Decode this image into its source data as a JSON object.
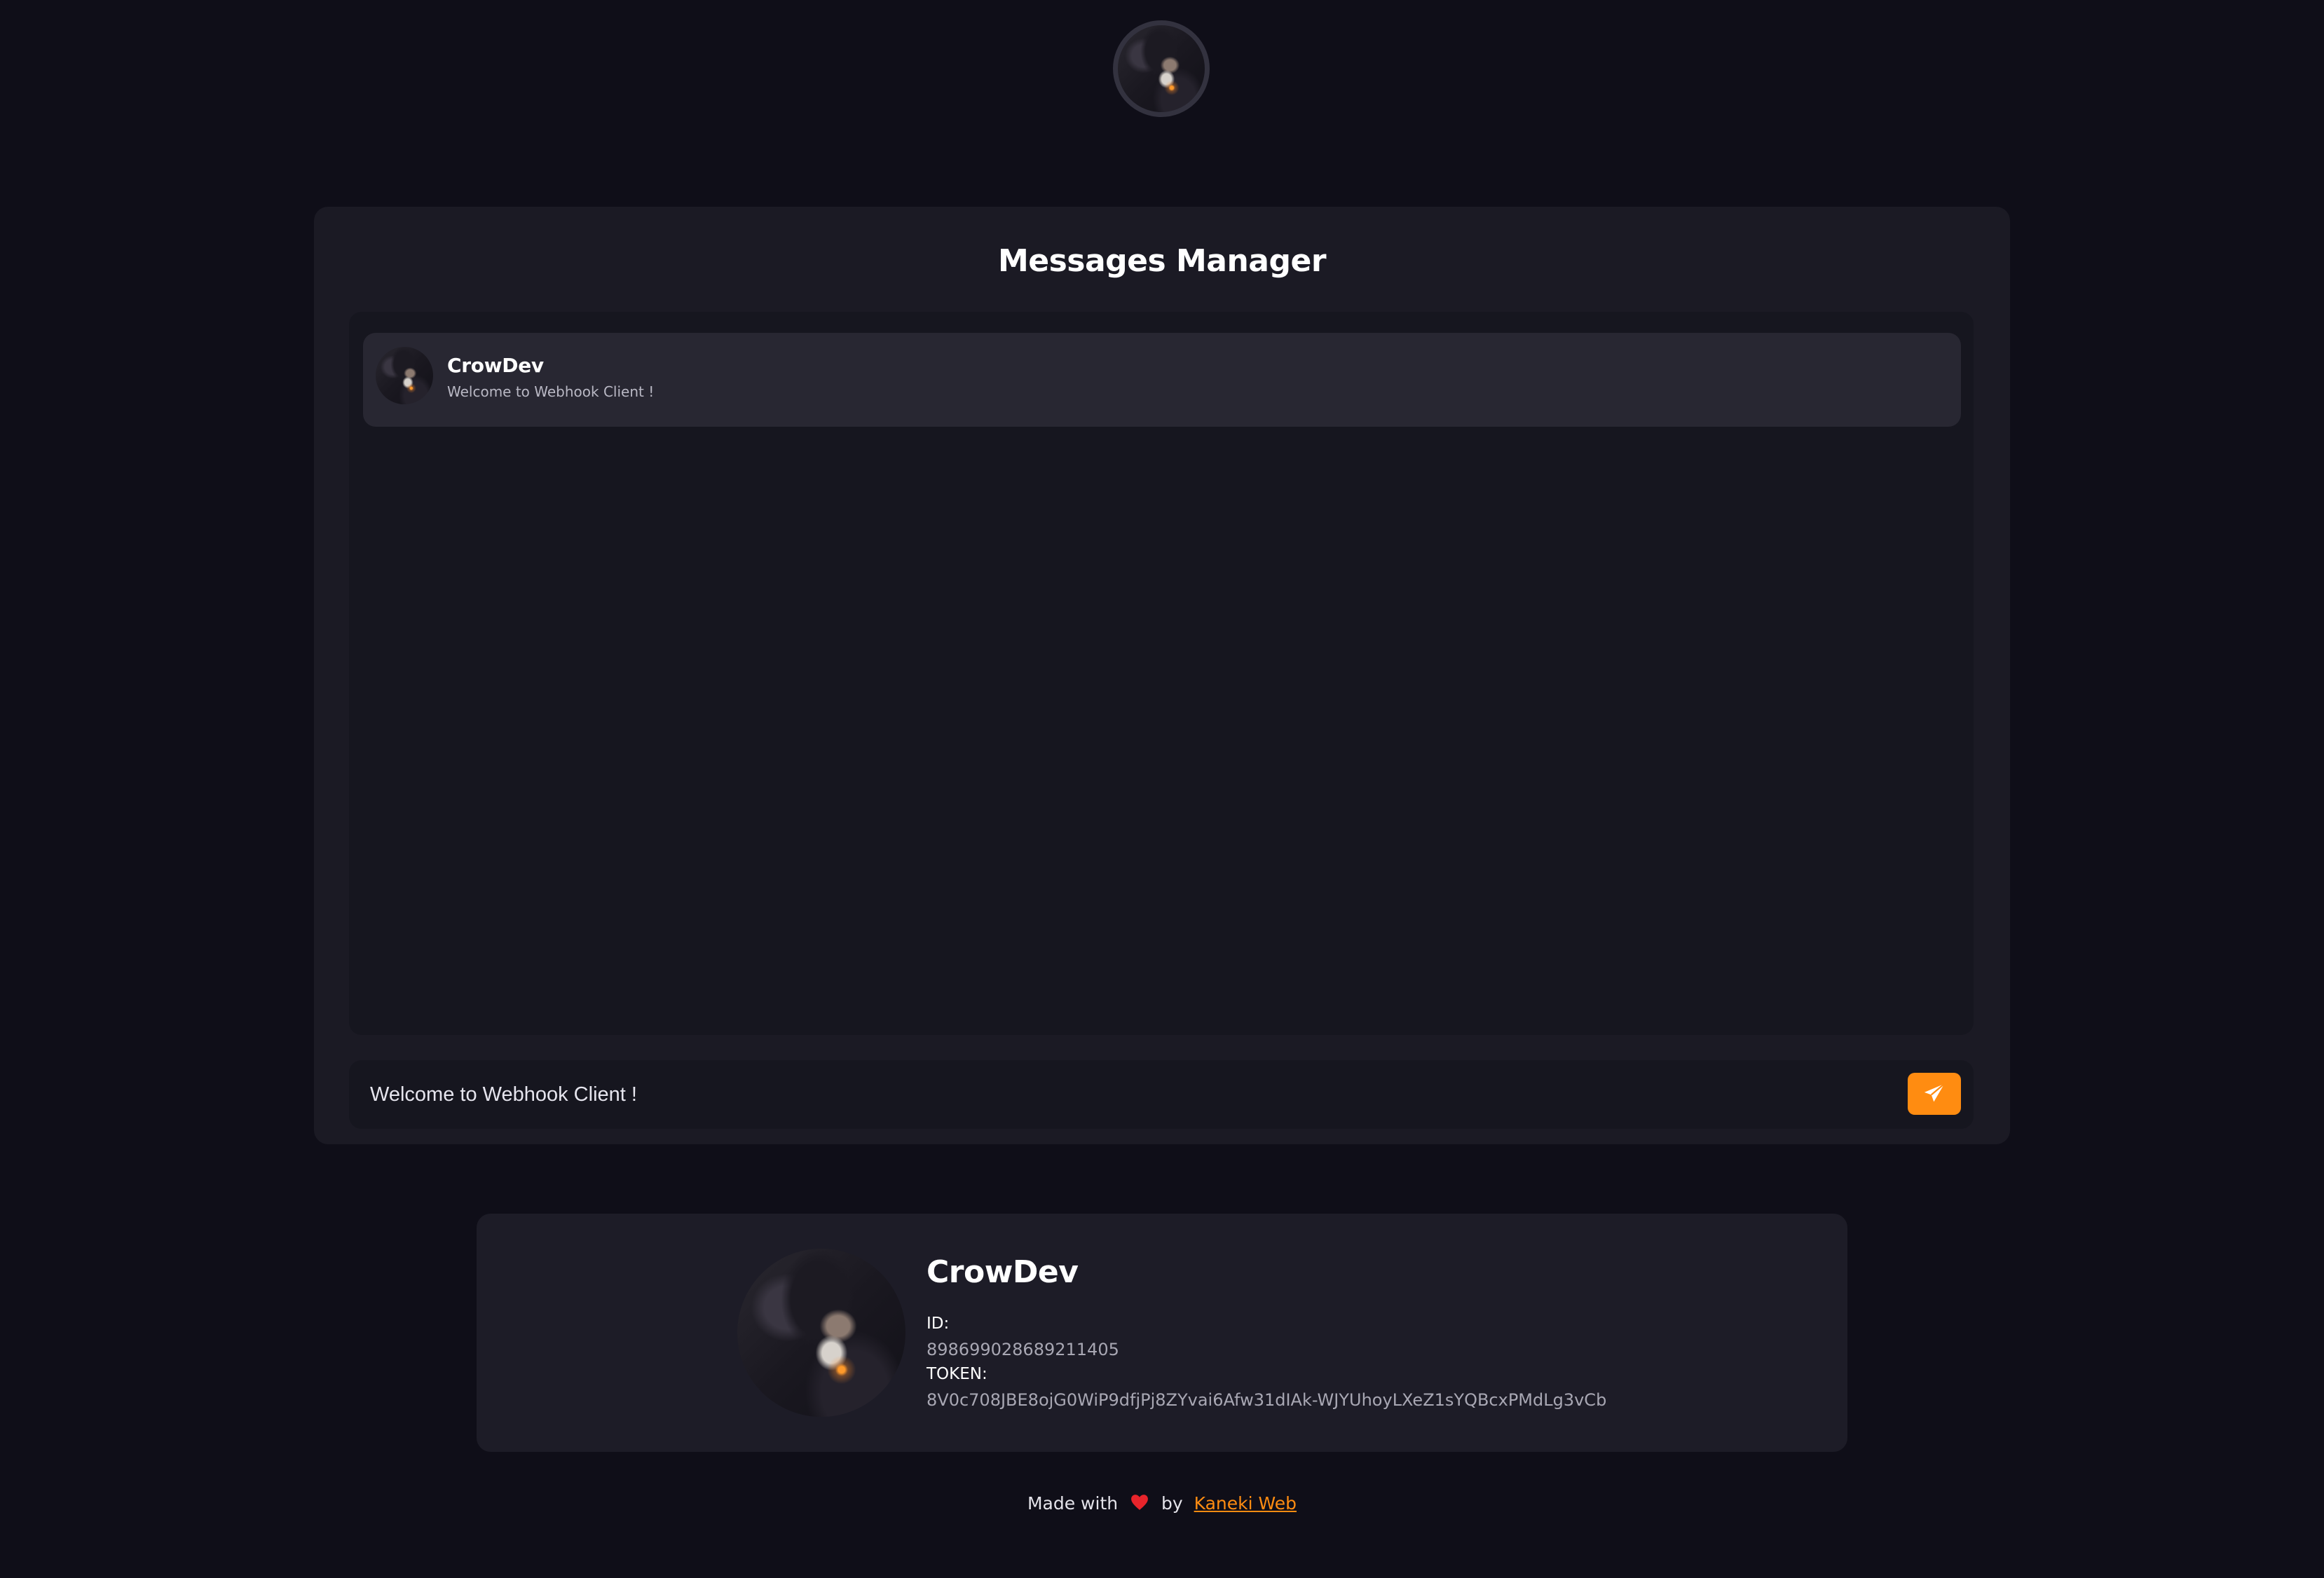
{
  "header": {
    "avatar_alt": "CrowDev avatar"
  },
  "panel": {
    "title": "Messages Manager",
    "messages": [
      {
        "author": "CrowDev",
        "text": "Welcome to Webhook Client !"
      }
    ],
    "composer": {
      "value": "Welcome to Webhook Client !",
      "placeholder": ""
    },
    "send_icon": "paper-plane-icon"
  },
  "profile": {
    "name": "CrowDev",
    "id_label": "ID:",
    "id_value": "898699028689211405",
    "token_label": "TOKEN:",
    "token_value": "8V0c708JBE8ojG0WiP9dfjPj8ZYvai6Afw31dIAk-WJYUhoyLXeZ1sYQBcxPMdLg3vCb"
  },
  "footer": {
    "made_with": "Made with",
    "heart_icon": "heart-icon",
    "by": "by",
    "link_text": "Kaneki Web"
  },
  "colors": {
    "background": "#0f0e18",
    "panel": "#1b1a24",
    "accent": "#ff8c11",
    "heart": "#e8242b"
  }
}
